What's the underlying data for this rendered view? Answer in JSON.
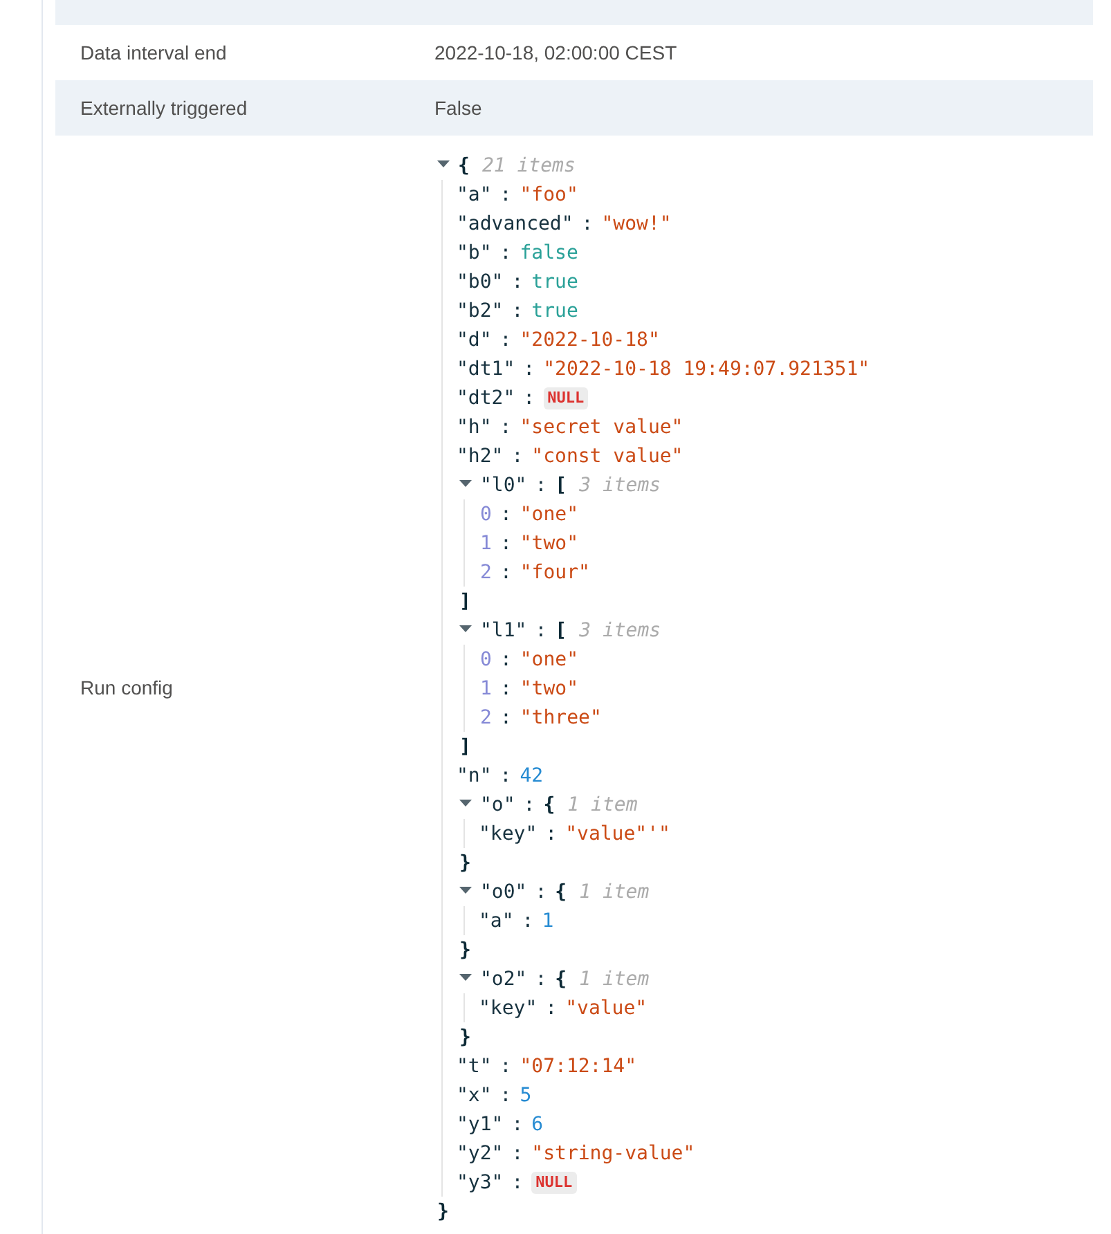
{
  "rows": [
    {
      "kind": "cut_off"
    },
    {
      "kind": "text",
      "label": "Data interval end",
      "value": "2022-10-18, 02:00:00 CEST"
    },
    {
      "kind": "text",
      "label": "Externally triggered",
      "value": "False"
    },
    {
      "kind": "json",
      "label": "Run config",
      "value": {
        "kind": "object",
        "open": "{",
        "count": "21 items",
        "expanded": true,
        "close": "}",
        "entries": [
          {
            "kind": "string",
            "key": "\"a\"",
            "sep": ":",
            "value": "\"foo\""
          },
          {
            "kind": "string",
            "key": "\"advanced\"",
            "sep": ":",
            "value": "\"wow!\""
          },
          {
            "kind": "boolean",
            "key": "\"b\"",
            "sep": ":",
            "value": "false"
          },
          {
            "kind": "boolean",
            "key": "\"b0\"",
            "sep": ":",
            "value": "true"
          },
          {
            "kind": "boolean",
            "key": "\"b2\"",
            "sep": ":",
            "value": "true"
          },
          {
            "kind": "string",
            "key": "\"d\"",
            "sep": ":",
            "value": "\"2022-10-18\""
          },
          {
            "kind": "string",
            "key": "\"dt1\"",
            "sep": ":",
            "value": "\"2022-10-18 19:49:07.921351\""
          },
          {
            "kind": "null",
            "key": "\"dt2\"",
            "sep": ":",
            "value": "NULL"
          },
          {
            "kind": "string",
            "key": "\"h\"",
            "sep": ":",
            "value": "\"secret value\""
          },
          {
            "kind": "string",
            "key": "\"h2\"",
            "sep": ":",
            "value": "\"const value\""
          },
          {
            "kind": "array",
            "key": "\"l0\"",
            "sep": ":",
            "open": "[",
            "count": "3 items",
            "expanded": true,
            "close": "]",
            "entries": [
              {
                "kind": "string",
                "key": "0",
                "sep": ":",
                "value": "\"one\""
              },
              {
                "kind": "string",
                "key": "1",
                "sep": ":",
                "value": "\"two\""
              },
              {
                "kind": "string",
                "key": "2",
                "sep": ":",
                "value": "\"four\""
              }
            ]
          },
          {
            "kind": "array",
            "key": "\"l1\"",
            "sep": ":",
            "open": "[",
            "count": "3 items",
            "expanded": true,
            "close": "]",
            "entries": [
              {
                "kind": "string",
                "key": "0",
                "sep": ":",
                "value": "\"one\""
              },
              {
                "kind": "string",
                "key": "1",
                "sep": ":",
                "value": "\"two\""
              },
              {
                "kind": "string",
                "key": "2",
                "sep": ":",
                "value": "\"three\""
              }
            ]
          },
          {
            "kind": "number",
            "key": "\"n\"",
            "sep": ":",
            "value": "42"
          },
          {
            "kind": "object",
            "key": "\"o\"",
            "sep": ":",
            "open": "{",
            "count": "1 item",
            "expanded": true,
            "close": "}",
            "entries": [
              {
                "kind": "string",
                "key": "\"key\"",
                "sep": ":",
                "value": "\"value\"'\""
              }
            ]
          },
          {
            "kind": "object",
            "key": "\"o0\"",
            "sep": ":",
            "open": "{",
            "count": "1 item",
            "expanded": true,
            "close": "}",
            "entries": [
              {
                "kind": "number",
                "key": "\"a\"",
                "sep": ":",
                "value": "1"
              }
            ]
          },
          {
            "kind": "object",
            "key": "\"o2\"",
            "sep": ":",
            "open": "{",
            "count": "1 item",
            "expanded": true,
            "close": "}",
            "entries": [
              {
                "kind": "string",
                "key": "\"key\"",
                "sep": ":",
                "value": "\"value\""
              }
            ]
          },
          {
            "kind": "string",
            "key": "\"t\"",
            "sep": ":",
            "value": "\"07:12:14\""
          },
          {
            "kind": "number",
            "key": "\"x\"",
            "sep": ":",
            "value": "5"
          },
          {
            "kind": "number",
            "key": "\"y1\"",
            "sep": ":",
            "value": "6"
          },
          {
            "kind": "string",
            "key": "\"y2\"",
            "sep": ":",
            "value": "\"string-value\""
          },
          {
            "kind": "null",
            "key": "\"y3\"",
            "sep": ":",
            "value": "NULL"
          }
        ]
      }
    }
  ]
}
